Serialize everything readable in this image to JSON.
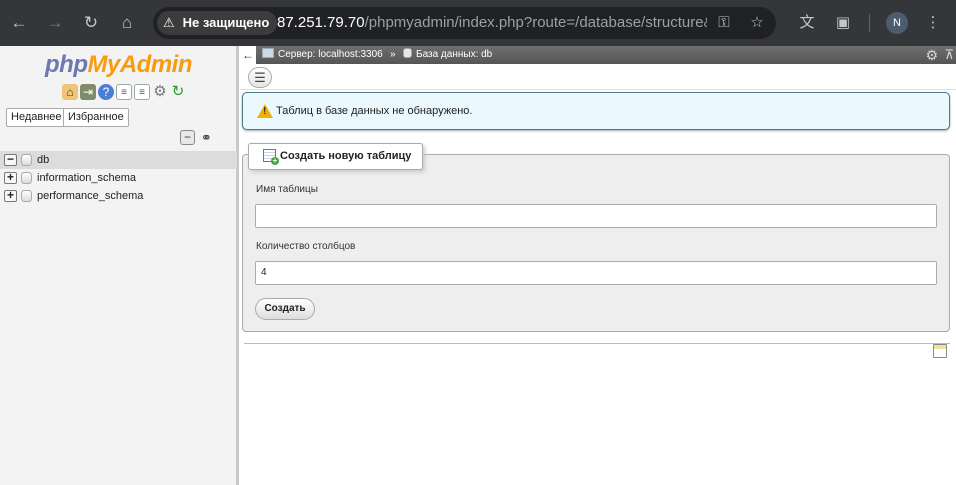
{
  "browser": {
    "security_label": "Не защищено",
    "url_host": "87.251.79.70",
    "url_path": "/phpmyadmin/index.php?route=/database/structure&...",
    "avatar_letter": "N",
    "icons": [
      "back-icon",
      "forward-icon",
      "reload-icon",
      "home-icon",
      "key-icon",
      "star-icon",
      "translate-icon",
      "extensions-icon",
      "menu-icon"
    ]
  },
  "sidebar": {
    "logo_part1": "php",
    "logo_part2": "MyAdmin",
    "tabs": [
      "Недавнее",
      "Избранное"
    ],
    "databases": [
      {
        "name": "db",
        "expander": "−",
        "selected": true
      },
      {
        "name": "information_schema",
        "expander": "+",
        "selected": false
      },
      {
        "name": "performance_schema",
        "expander": "+",
        "selected": false
      }
    ]
  },
  "breadcrumb": {
    "server": "Сервер: localhost:3306",
    "separator": "»",
    "database": "База данных: db"
  },
  "notice": {
    "message": "Таблиц в базе данных не обнаружено."
  },
  "create_table": {
    "legend": "Создать новую таблицу",
    "name_label": "Имя таблицы",
    "name_value": "",
    "columns_label": "Количество столбцов",
    "columns_value": "4",
    "submit_label": "Создать"
  },
  "colors": {
    "chrome_bg": "#35363a",
    "logo_php": "#6c78af",
    "logo_myadmin": "#f89c0e",
    "notice_bg": "#ebf8fd",
    "topbar": "#666666"
  }
}
